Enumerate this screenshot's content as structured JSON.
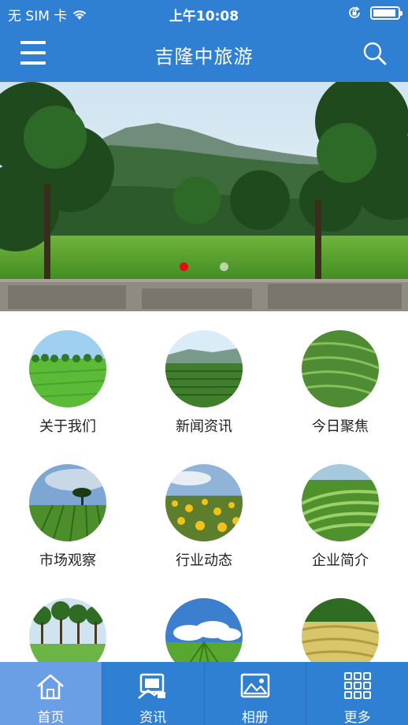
{
  "status_bar": {
    "carrier": "无 SIM 卡",
    "time": "上午10:08",
    "battery_level": 0.95
  },
  "header": {
    "title": "吉隆中旅游",
    "menu_icon": "hamburger-menu-icon",
    "search_icon": "search-icon"
  },
  "banner": {
    "image": "landscape-photo",
    "page_count": 2,
    "active_index": 0,
    "active_dot_color": "#e10f0f"
  },
  "grid": {
    "items": [
      {
        "label": "关于我们",
        "image": "tea-field-with-trees"
      },
      {
        "label": "新闻资讯",
        "image": "hill-plantation"
      },
      {
        "label": "今日聚焦",
        "image": "terraced-tea-slope"
      },
      {
        "label": "市场观察",
        "image": "lone-tree-field"
      },
      {
        "label": "行业动态",
        "image": "sunflower-field"
      },
      {
        "label": "企业简介",
        "image": "curved-tea-rows"
      },
      {
        "label": "",
        "image": "palm-trees-field"
      },
      {
        "label": "",
        "image": "cloudy-sky-rows"
      },
      {
        "label": "",
        "image": "golden-terraces"
      }
    ]
  },
  "tabbar": {
    "tabs": [
      {
        "label": "首页",
        "icon": "home-icon",
        "active": true
      },
      {
        "label": "资讯",
        "icon": "news-icon",
        "active": false
      },
      {
        "label": "相册",
        "icon": "photo-album-icon",
        "active": false
      },
      {
        "label": "更多",
        "icon": "grid-more-icon",
        "active": false
      }
    ]
  },
  "colors": {
    "primary": "#2f7fd3",
    "active_tab": "#6a9fe6",
    "text": "#222222"
  }
}
